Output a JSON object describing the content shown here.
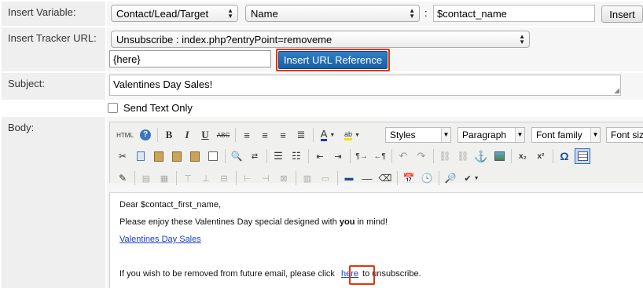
{
  "labels": {
    "insert_variable": "Insert Variable:",
    "insert_tracker_url": "Insert Tracker URL:",
    "subject": "Subject:",
    "body": "Body:"
  },
  "insert_variable": {
    "module_select": "Contact/Lead/Target",
    "field_select": "Name",
    "colon": ":",
    "variable_value": "$contact_name",
    "insert_button": "Insert"
  },
  "tracker": {
    "url_select": "Unsubscribe : index.php?entryPoint=removeme",
    "link_text_value": "{here}",
    "insert_url_button": "Insert URL Reference"
  },
  "subject": {
    "value": "Valentines Day Sales!"
  },
  "send_text_only": {
    "label": "Send Text Only",
    "checked": false
  },
  "toolbar": {
    "html_label": "HTML",
    "styles_select": "Styles",
    "format_select": "Paragraph",
    "font_family_select": "Font family",
    "font_size_select": "Font size"
  },
  "body_content": {
    "greeting": "Dear $contact_first_name,",
    "line2_before": "Please enjoy these Valentines Day special designed with ",
    "line2_bold": "you",
    "line2_after": " in mind!",
    "link_text": "Valentines Day Sales",
    "unsub_before": "If you wish to be removed from future email, please click ",
    "unsub_link": "here",
    "unsub_after": " to unsubscribe."
  },
  "colors": {
    "highlight": "#e2340d",
    "primary_button": "#1f6fb8",
    "label_bg": "#efefef",
    "link": "#1a3ecf"
  }
}
